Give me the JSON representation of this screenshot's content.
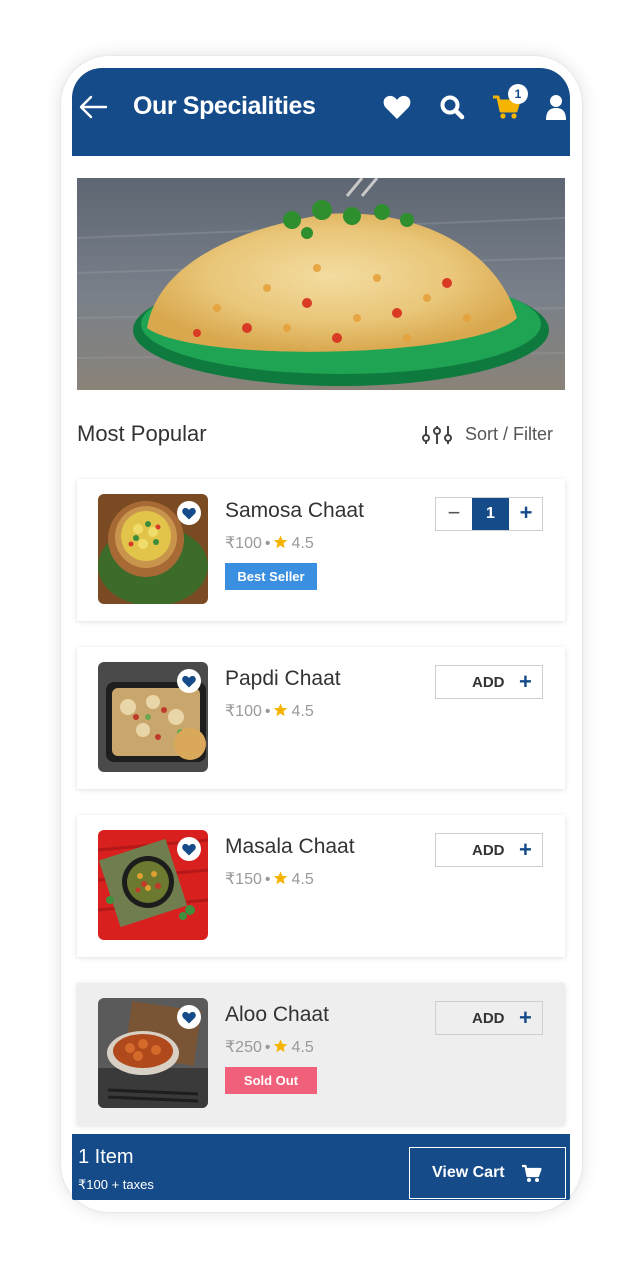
{
  "header": {
    "title": "Our Specialities",
    "cart_badge": "1",
    "icons": [
      "back-arrow-icon",
      "heart-icon",
      "search-icon",
      "cart-icon",
      "user-icon"
    ]
  },
  "banner": {
    "image": "bhel-puri-banner"
  },
  "section": {
    "title": "Most Popular",
    "sort_filter_label": "Sort / Filter"
  },
  "products": [
    {
      "name": "Samosa Chaat",
      "price": "₹100",
      "rating": "4.5",
      "tag": "Best Seller",
      "action": "stepper",
      "quantity": "1",
      "favorited": true
    },
    {
      "name": "Papdi Chaat",
      "price": "₹100",
      "rating": "4.5",
      "tag": "",
      "action": "add",
      "add_label": "ADD",
      "favorited": true
    },
    {
      "name": "Masala Chaat",
      "price": "₹150",
      "rating": "4.5",
      "tag": "",
      "action": "add",
      "add_label": "ADD",
      "favorited": true
    },
    {
      "name": "Aloo Chaat",
      "price": "₹250",
      "rating": "4.5",
      "tag": "Sold Out",
      "action": "add",
      "add_label": "ADD",
      "favorited": true
    }
  ],
  "stepper": {
    "minus": "−",
    "plus": "+"
  },
  "cart_bar": {
    "count": "1 Item",
    "total": "₹100 + taxes",
    "button_label": "View Cart"
  },
  "colors": {
    "primary": "#144b88",
    "accent_yellow": "#f5b400",
    "best_seller": "#3a8fe0",
    "sold_out": "#f0607a"
  }
}
